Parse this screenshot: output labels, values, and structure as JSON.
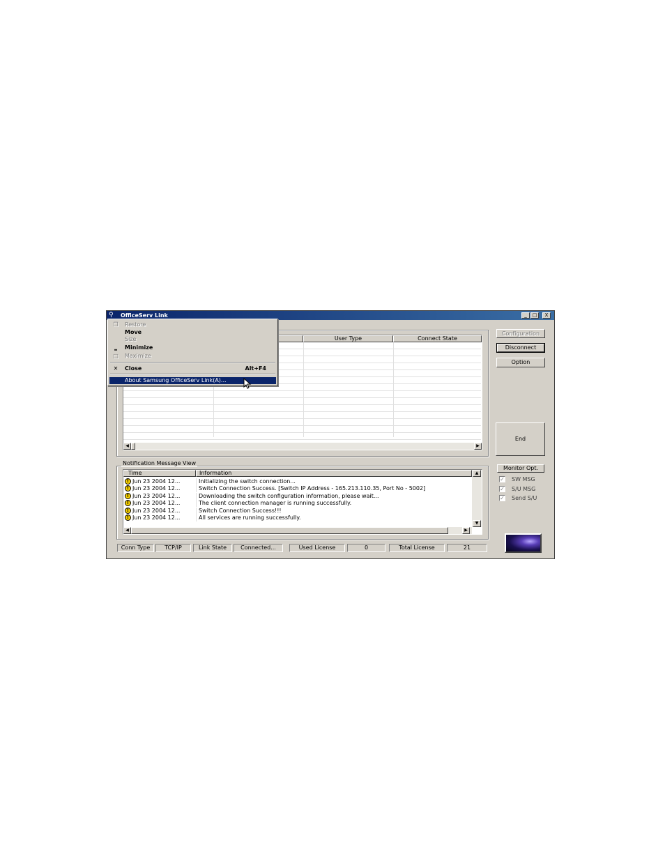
{
  "window": {
    "title": "OfficeServ Link",
    "minimize": "_",
    "maximize": "□",
    "close": "X"
  },
  "system_menu": {
    "items": [
      {
        "label": "Restore",
        "icon": "restore-icon",
        "glyph": "❐",
        "accelerator": "",
        "disabled": true
      },
      {
        "label": "Move",
        "icon": "",
        "glyph": "",
        "accelerator": "",
        "disabled": false
      },
      {
        "label": "Size",
        "icon": "",
        "glyph": "",
        "accelerator": "",
        "disabled": true
      },
      {
        "label": "Minimize",
        "icon": "minimize-icon",
        "glyph": "‗",
        "accelerator": "",
        "disabled": false
      },
      {
        "label": "Maximize",
        "icon": "maximize-icon",
        "glyph": "□",
        "accelerator": "",
        "disabled": true
      },
      {
        "label": "Close",
        "icon": "close-icon",
        "glyph": "✕",
        "accelerator": "Alt+F4",
        "disabled": false
      },
      {
        "label": "About Samsung OfficeServ Link(A)...",
        "icon": "",
        "glyph": "",
        "accelerator": "",
        "disabled": false
      }
    ]
  },
  "user_grid": {
    "columns": [
      "",
      "",
      "User Type",
      "Connect State"
    ]
  },
  "buttons": {
    "configuration": "Configuration",
    "disconnect": "Disconnect",
    "option": "Option",
    "end": "End",
    "monitor_opt": "Monitor Opt."
  },
  "monitor_options": [
    {
      "label": "SW MSG",
      "checked": true
    },
    {
      "label": "S/U MSG",
      "checked": true
    },
    {
      "label": "Send S/U",
      "checked": true
    }
  ],
  "notification": {
    "title": "Notification Message View",
    "columns": [
      "Time",
      "Information"
    ],
    "rows": [
      {
        "time": "Jun 23 2004 12...",
        "info": "Initializing the switch connection..."
      },
      {
        "time": "Jun 23 2004 12...",
        "info": "Switch Connection Success. [Switch IP Address - 165.213.110.35, Port No - 5002]"
      },
      {
        "time": "Jun 23 2004 12...",
        "info": "Downloading the switch configuration information, please wait..."
      },
      {
        "time": "Jun 23 2004 12...",
        "info": "The client connection manager is running successfully."
      },
      {
        "time": "Jun 23 2004 12...",
        "info": "Switch Connection Success!!!"
      },
      {
        "time": "Jun 23 2004 12...",
        "info": "All services are running successfully."
      }
    ]
  },
  "status_bar": {
    "conn_type_label": "Conn Type",
    "conn_type": "TCP/IP",
    "link_state_label": "Link State",
    "link_state": "Connected...",
    "used_license_label": "Used License",
    "used_license": "0",
    "total_license_label": "Total License",
    "total_license": "21"
  },
  "colors": {
    "titlebar": "#0a246a",
    "menu_highlight": "#0a246a",
    "warning": "#f7d000",
    "face": "#d4d0c8"
  }
}
